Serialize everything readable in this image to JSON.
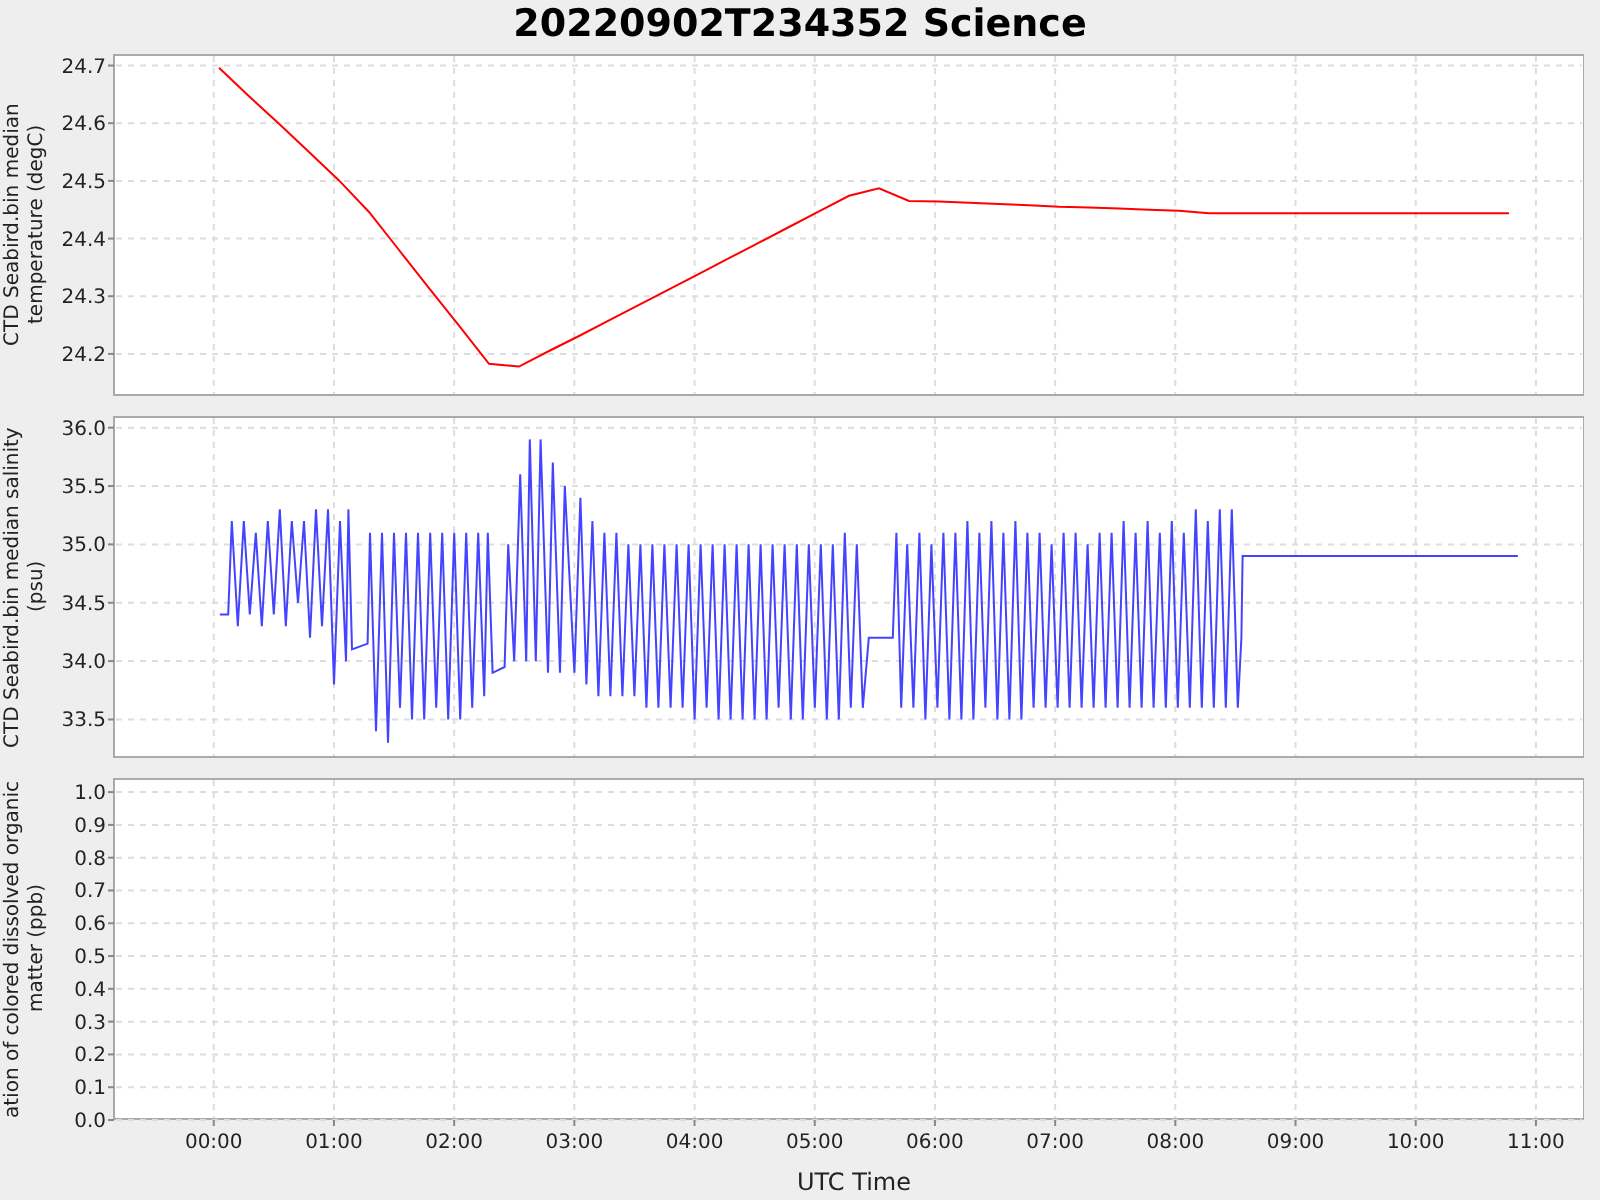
{
  "title": "20220902T234352 Science",
  "panels": [
    {
      "kind": "chart",
      "chart_data": {
        "type": "line",
        "ylabel": "CTD Seabird.bin median temperature (degC)",
        "ylim": [
          24.127,
          24.72
        ],
        "grid": true,
        "yticks": [
          {
            "value": 24.2,
            "label": "24.2"
          },
          {
            "value": 24.3,
            "label": "24.3"
          },
          {
            "value": 24.4,
            "label": "24.4"
          },
          {
            "value": 24.5,
            "label": "24.5"
          },
          {
            "value": 24.6,
            "label": "24.6"
          },
          {
            "value": 24.7,
            "label": "24.7"
          }
        ],
        "categories": [
          null,
          null,
          null,
          null,
          null,
          null,
          null,
          null,
          null,
          null,
          null,
          null,
          null,
          null,
          null,
          null,
          null,
          null,
          null,
          null,
          null,
          null,
          null,
          null,
          null,
          null,
          null,
          null,
          null,
          null,
          null,
          null,
          null,
          null,
          null,
          null,
          null,
          null,
          null,
          null,
          null,
          null,
          null,
          null,
          null,
          null,
          null,
          null,
          null
        ],
        "series": [
          {
            "color": "#ff0000",
            "values": [
              null,
              null,
              null,
              24.696,
              24.647,
              24.599,
              24.55,
              24.501,
              24.446,
              24.38,
              24.314,
              24.249,
              24.183,
              24.178,
              24.205,
              24.231,
              24.258,
              24.285,
              24.312,
              24.339,
              24.366,
              24.393,
              24.42,
              24.447,
              24.474,
              24.487,
              24.465,
              24.464,
              24.462,
              24.46,
              24.458,
              24.455,
              24.454,
              24.452,
              24.45,
              24.448,
              24.444,
              24.444,
              24.444,
              24.444,
              24.444,
              24.444,
              24.444,
              24.444,
              24.444,
              24.444,
              24.444,
              null,
              null
            ]
          }
        ]
      }
    },
    {
      "kind": "waveform",
      "ylabel": "CTD Seabird.bin median salinity (psu)",
      "yticks": [
        "36.0",
        "35.5",
        "35.0",
        "34.5",
        "34.0",
        "33.5"
      ]
    },
    {
      "kind": "empty",
      "ylabel": "ation of colored dissolved organic matter (ppb)",
      "yticks": [
        "1.0",
        "0.9",
        "0.8",
        "0.7",
        "0.6",
        "0.5",
        "0.4",
        "0.3",
        "0.2",
        "0.1",
        "0.0"
      ]
    }
  ],
  "x_axis": {
    "tick_labels": [
      "00:00",
      "01:00",
      "02:00",
      "03:00",
      "04:00",
      "05:00",
      "06:00",
      "07:00",
      "08:00",
      "09:00",
      "10:00",
      "11:00"
    ],
    "label": "UTC Time"
  }
}
